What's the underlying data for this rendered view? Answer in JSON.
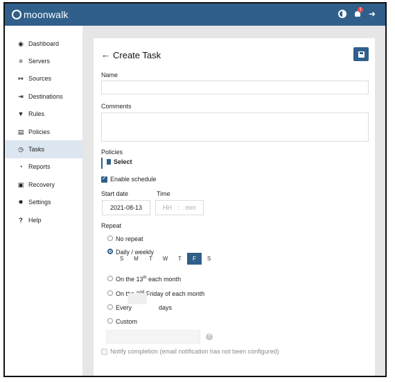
{
  "app": {
    "name": "moonwalk",
    "notification_count": "1"
  },
  "colors": {
    "brand": "#2f5f8a",
    "badge": "#e04b4b",
    "active_nav": "#dce6f0",
    "background": "#e6e6e6"
  },
  "topbar_icons": [
    "contrast-icon",
    "bell-icon",
    "logout-icon"
  ],
  "sidebar": {
    "items": [
      {
        "label": "Dashboard",
        "icon": "dashboard-icon"
      },
      {
        "label": "Servers",
        "icon": "server-icon"
      },
      {
        "label": "Sources",
        "icon": "source-icon"
      },
      {
        "label": "Destinations",
        "icon": "destination-icon"
      },
      {
        "label": "Rules",
        "icon": "filter-icon"
      },
      {
        "label": "Policies",
        "icon": "table-icon"
      },
      {
        "label": "Tasks",
        "icon": "clock-icon",
        "active": true
      },
      {
        "label": "Reports",
        "icon": "pie-chart-icon"
      },
      {
        "label": "Recovery",
        "icon": "briefcase-icon"
      },
      {
        "label": "Settings",
        "icon": "gear-icon"
      },
      {
        "label": "Help",
        "icon": "question-icon"
      }
    ]
  },
  "form": {
    "title": "Create Task",
    "name_label": "Name",
    "name_value": "",
    "comments_label": "Comments",
    "comments_value": "",
    "policies_label": "Policies",
    "select_label": "Select",
    "enable_schedule_label": "Enable schedule",
    "enable_schedule_checked": true,
    "start_date_label": "Start date",
    "start_date_value": "2021-08-13",
    "time_label": "Time",
    "time_hh": "HH",
    "time_sep": ":",
    "time_mm": "mm",
    "repeat_label": "Repeat",
    "repeat_options": [
      {
        "label": "No repeat",
        "selected": false
      },
      {
        "label": "Daily / weekly",
        "selected": true
      },
      {
        "label_pre": "On the 13",
        "label_sup": "th",
        "label_post": " each month",
        "selected": false
      },
      {
        "label_pre": "On the 2",
        "label_sup": "nd",
        "label_post": " Friday of each month",
        "selected": false
      },
      {
        "label_pre": "Every",
        "label_post": "days",
        "selected": false
      },
      {
        "label": "Custom",
        "selected": false
      }
    ],
    "weekdays": [
      "S",
      "M",
      "T",
      "W",
      "T",
      "F",
      "S"
    ],
    "selected_weekday_index": 5,
    "notify_label": "Notify completion (email notification has not been configured)",
    "notify_checked": false
  }
}
